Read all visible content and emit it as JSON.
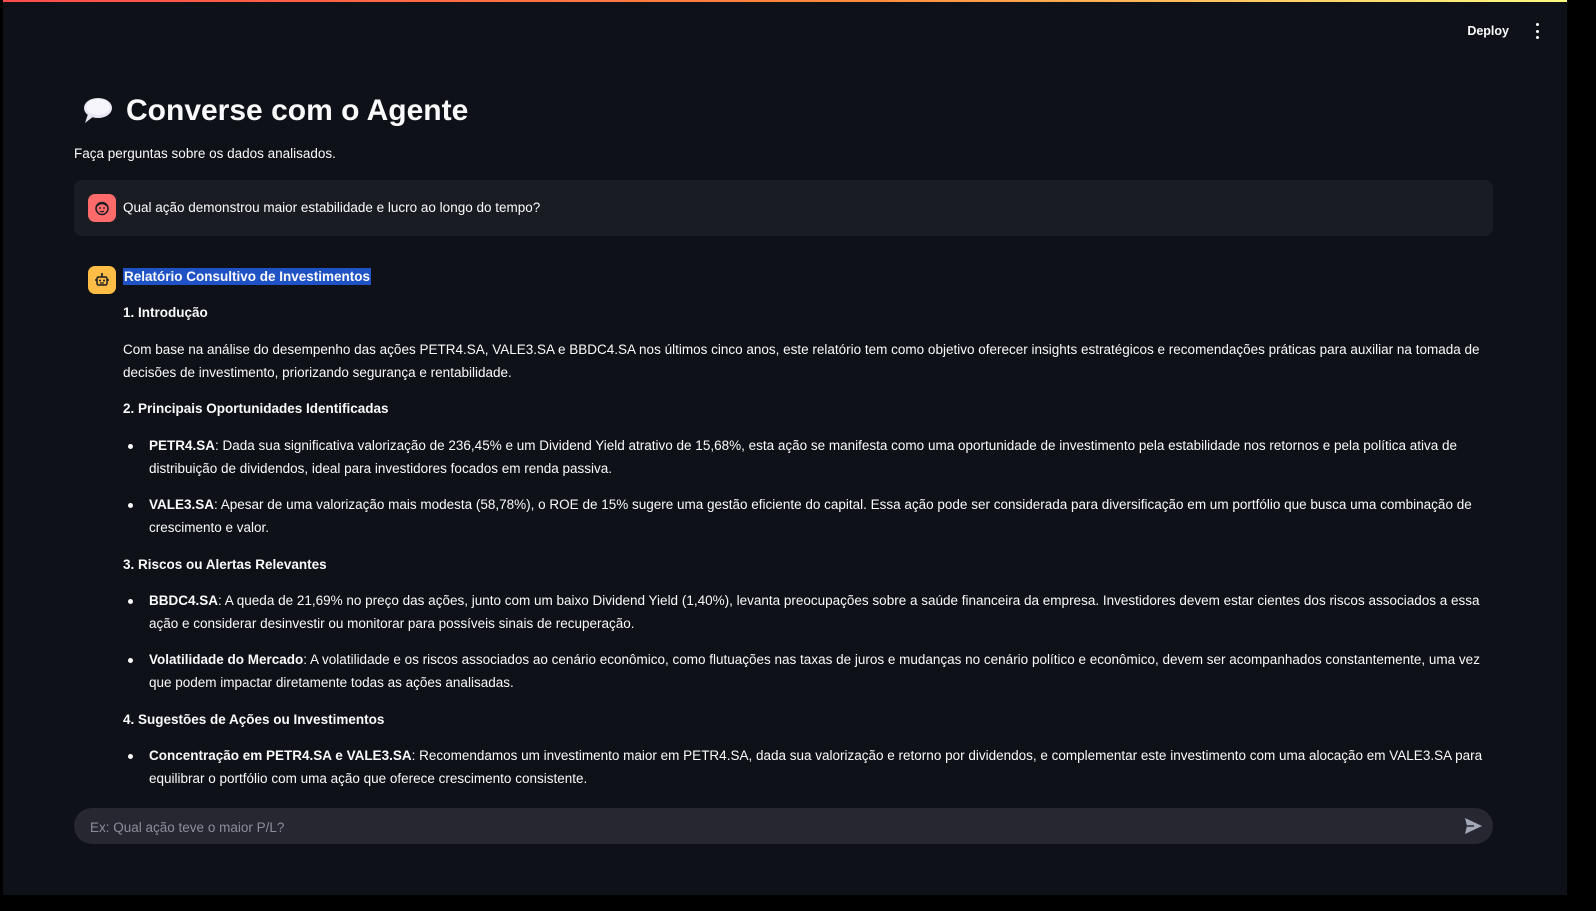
{
  "header": {
    "deploy_label": "Deploy",
    "menu_icon": "kebab-menu-icon",
    "accent_gradient": [
      "#ff4b4b",
      "#ff8a3d",
      "#fffd80"
    ]
  },
  "page": {
    "title_icon": "speech-balloon-icon",
    "title": "Converse com o Agente",
    "subtitle": "Faça perguntas sobre os dados analisados."
  },
  "messages": {
    "user": {
      "avatar_icon": "user-face-icon",
      "avatar_color": "#ff6b6b",
      "text": "Qual ação demonstrou maior estabilidade e lucro ao longo do tempo?"
    },
    "assistant": {
      "avatar_icon": "robot-icon",
      "avatar_color": "#ffbd45",
      "title": "Relatório Consultivo de Investimentos",
      "s1_heading": "1. Introdução",
      "s1_text": "Com base na análise do desempenho das ações PETR4.SA, VALE3.SA e BBDC4.SA nos últimos cinco anos, este relatório tem como objetivo oferecer insights estratégicos e recomendações práticas para auxiliar na tomada de decisões de investimento, priorizando segurança e rentabilidade.",
      "s2_heading": "2. Principais Oportunidades Identificadas",
      "s2_items": [
        {
          "label": "PETR4.SA",
          "text": ": Dada sua significativa valorização de 236,45% e um Dividend Yield atrativo de 15,68%, esta ação se manifesta como uma oportunidade de investimento pela estabilidade nos retornos e pela política ativa de distribuição de dividendos, ideal para investidores focados em renda passiva."
        },
        {
          "label": "VALE3.SA",
          "text": ": Apesar de uma valorização mais modesta (58,78%), o ROE de 15% sugere uma gestão eficiente do capital. Essa ação pode ser considerada para diversificação em um portfólio que busca uma combinação de crescimento e valor."
        }
      ],
      "s3_heading": "3. Riscos ou Alertas Relevantes",
      "s3_items": [
        {
          "label": "BBDC4.SA",
          "text": ": A queda de 21,69% no preço das ações, junto com um baixo Dividend Yield (1,40%), levanta preocupações sobre a saúde financeira da empresa. Investidores devem estar cientes dos riscos associados a essa ação e considerar desinvestir ou monitorar para possíveis sinais de recuperação."
        },
        {
          "label": "Volatilidade do Mercado",
          "text": ": A volatilidade e os riscos associados ao cenário econômico, como flutuações nas taxas de juros e mudanças no cenário político e econômico, devem ser acompanhados constantemente, uma vez que podem impactar diretamente todas as ações analisadas."
        }
      ],
      "s4_heading": "4. Sugestões de Ações ou Investimentos",
      "s4_items": [
        {
          "label": "Concentração em PETR4.SA e VALE3.SA",
          "text": ": Recomendamos um investimento maior em PETR4.SA, dada sua valorização e retorno por dividendos, e complementar este investimento com uma alocação em VALE3.SA para equilibrar o portfólio com uma ação que oferece crescimento consistente."
        }
      ]
    }
  },
  "chat_input": {
    "placeholder": "Ex: Qual ação teve o maior P/L?",
    "value": "",
    "send_icon": "send-icon"
  }
}
